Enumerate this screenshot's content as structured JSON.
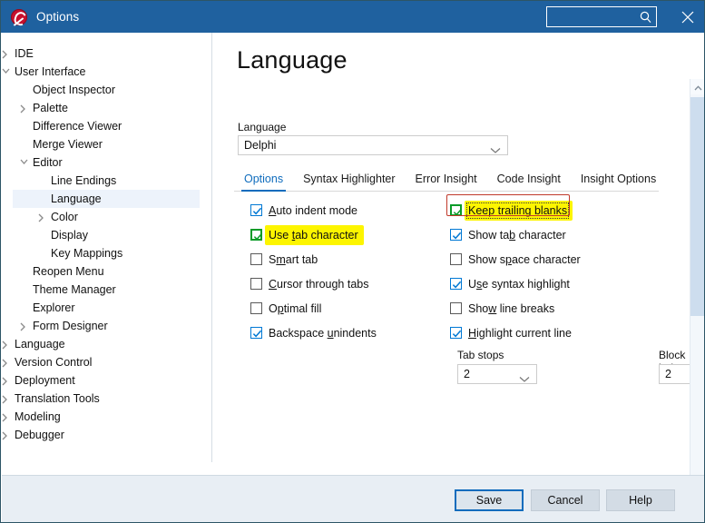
{
  "window": {
    "title": "Options",
    "logo_icon": "embarcadero-logo-icon",
    "close_icon": "close-icon"
  },
  "search": {
    "value": "",
    "placeholder": "",
    "icon": "search-icon"
  },
  "sidebar": {
    "items": [
      {
        "label": "IDE",
        "depth": 0,
        "state": "collapsed",
        "selected": false
      },
      {
        "label": "User Interface",
        "depth": 0,
        "state": "expanded",
        "selected": false
      },
      {
        "label": "Object Inspector",
        "depth": 1,
        "state": "leaf",
        "selected": false
      },
      {
        "label": "Palette",
        "depth": 1,
        "state": "collapsed",
        "selected": false
      },
      {
        "label": "Difference Viewer",
        "depth": 1,
        "state": "leaf",
        "selected": false
      },
      {
        "label": "Merge Viewer",
        "depth": 1,
        "state": "leaf",
        "selected": false
      },
      {
        "label": "Editor",
        "depth": 1,
        "state": "expanded",
        "selected": false
      },
      {
        "label": "Line Endings",
        "depth": 2,
        "state": "leaf",
        "selected": false
      },
      {
        "label": "Language",
        "depth": 2,
        "state": "leaf",
        "selected": true
      },
      {
        "label": "Color",
        "depth": 2,
        "state": "collapsed",
        "selected": false
      },
      {
        "label": "Display",
        "depth": 2,
        "state": "leaf",
        "selected": false
      },
      {
        "label": "Key Mappings",
        "depth": 2,
        "state": "leaf",
        "selected": false
      },
      {
        "label": "Reopen Menu",
        "depth": 1,
        "state": "leaf",
        "selected": false
      },
      {
        "label": "Theme Manager",
        "depth": 1,
        "state": "leaf",
        "selected": false
      },
      {
        "label": "Explorer",
        "depth": 1,
        "state": "leaf",
        "selected": false
      },
      {
        "label": "Form Designer",
        "depth": 1,
        "state": "collapsed",
        "selected": false
      },
      {
        "label": "Language",
        "depth": 0,
        "state": "collapsed",
        "selected": false
      },
      {
        "label": "Version Control",
        "depth": 0,
        "state": "collapsed",
        "selected": false
      },
      {
        "label": "Deployment",
        "depth": 0,
        "state": "collapsed",
        "selected": false
      },
      {
        "label": "Translation Tools",
        "depth": 0,
        "state": "collapsed",
        "selected": false
      },
      {
        "label": "Modeling",
        "depth": 0,
        "state": "collapsed",
        "selected": false
      },
      {
        "label": "Debugger",
        "depth": 0,
        "state": "collapsed",
        "selected": false
      }
    ]
  },
  "page": {
    "title": "Language",
    "language_label": "Language",
    "language_value": "Delphi"
  },
  "tabs": [
    {
      "label": "Options",
      "active": true
    },
    {
      "label": "Syntax Highlighter",
      "active": false
    },
    {
      "label": "Error Insight",
      "active": false
    },
    {
      "label": "Code Insight",
      "active": false
    },
    {
      "label": "Insight Options",
      "active": false
    }
  ],
  "options_left": [
    {
      "label": "Auto indent mode",
      "accel": "A",
      "checked": true,
      "highlighted": false,
      "focused": false
    },
    {
      "label": "Use tab character",
      "accel": "t",
      "checked": true,
      "highlighted": true,
      "focused": false
    },
    {
      "label": "Smart tab",
      "accel": "m",
      "checked": false,
      "highlighted": false,
      "focused": false
    },
    {
      "label": "Cursor through tabs",
      "accel": "C",
      "checked": false,
      "highlighted": false,
      "focused": false
    },
    {
      "label": "Optimal fill",
      "accel": "p",
      "checked": false,
      "highlighted": false,
      "focused": false
    },
    {
      "label": "Backspace unindents",
      "accel": "u",
      "checked": true,
      "highlighted": false,
      "focused": false
    }
  ],
  "options_right": [
    {
      "label": "Keep trailing blanks",
      "accel": "K",
      "checked": true,
      "highlighted": true,
      "focused": true
    },
    {
      "label": "Show tab character",
      "accel": "b",
      "checked": true,
      "highlighted": false,
      "focused": false
    },
    {
      "label": "Show space character",
      "accel": "p",
      "checked": false,
      "highlighted": false,
      "focused": false
    },
    {
      "label": "Use syntax highlight",
      "accel": "s",
      "checked": true,
      "highlighted": false,
      "focused": false
    },
    {
      "label": "Show line breaks",
      "accel": "w",
      "checked": false,
      "highlighted": false,
      "focused": false
    },
    {
      "label": "Highlight current line",
      "accel": "H",
      "checked": true,
      "highlighted": false,
      "focused": false
    }
  ],
  "spinners": {
    "tab_stops_label": "Tab stops",
    "tab_stops_value": "2",
    "block_indent_label": "Block indent",
    "block_indent_value": "2"
  },
  "footer": {
    "save_label": "Save",
    "cancel_label": "Cancel",
    "help_label": "Help"
  },
  "colors": {
    "titlebar": "#1f619f",
    "accent": "#0f6cbd",
    "checkbox_blue": "#0078d4",
    "checkbox_green": "#0a9b28",
    "highlight_yellow": "#fdf500",
    "annotation_red": "#c0392b",
    "selection": "#edf3fb",
    "footer": "#e8eef4"
  }
}
